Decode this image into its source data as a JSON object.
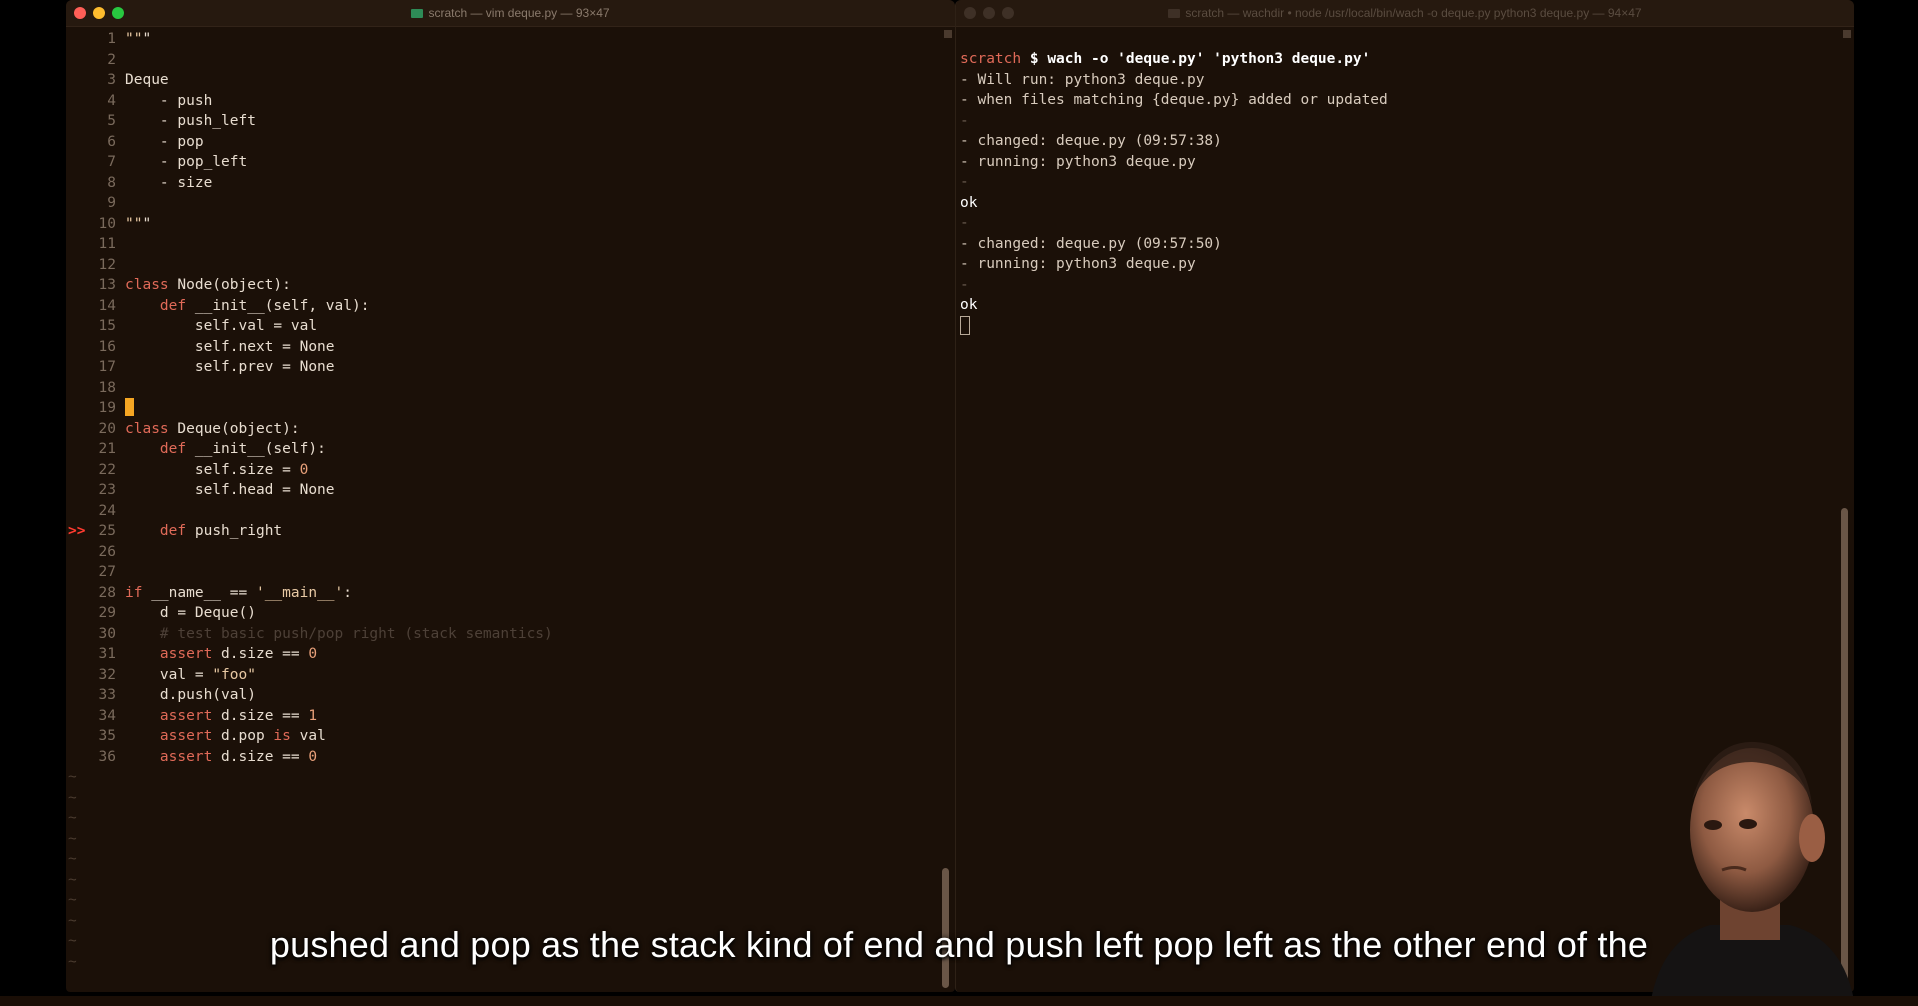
{
  "colors": {
    "close": "#ff5f57",
    "minimize": "#febc2e",
    "maximize": "#28c840",
    "folder": "#2e8b57"
  },
  "vim_window": {
    "title": "scratch — vim deque.py — 93×47",
    "lines": [
      {
        "n": "1",
        "t": "\"\"\""
      },
      {
        "n": "2",
        "t": ""
      },
      {
        "n": "3",
        "t": "Deque"
      },
      {
        "n": "4",
        "t": "    - push"
      },
      {
        "n": "5",
        "t": "    - push_left"
      },
      {
        "n": "6",
        "t": "    - pop"
      },
      {
        "n": "7",
        "t": "    - pop_left"
      },
      {
        "n": "8",
        "t": "    - size"
      },
      {
        "n": "9",
        "t": ""
      },
      {
        "n": "10",
        "t": "\"\"\""
      },
      {
        "n": "11",
        "t": ""
      },
      {
        "n": "12",
        "t": ""
      },
      {
        "n": "13",
        "t": "class Node(object):"
      },
      {
        "n": "14",
        "t": "    def __init__(self, val):"
      },
      {
        "n": "15",
        "t": "        self.val = val"
      },
      {
        "n": "16",
        "t": "        self.next = None"
      },
      {
        "n": "17",
        "t": "        self.prev = None"
      },
      {
        "n": "18",
        "t": ""
      },
      {
        "n": "19",
        "t": ""
      },
      {
        "n": "20",
        "t": "class Deque(object):"
      },
      {
        "n": "21",
        "t": "    def __init__(self):"
      },
      {
        "n": "22",
        "t": "        self.size = 0"
      },
      {
        "n": "23",
        "t": "        self.head = None"
      },
      {
        "n": "24",
        "t": ""
      },
      {
        "n": "25",
        "t": "    def push_right",
        "sign": ">>"
      },
      {
        "n": "26",
        "t": ""
      },
      {
        "n": "27",
        "t": ""
      },
      {
        "n": "28",
        "t": "if __name__ == '__main__':"
      },
      {
        "n": "29",
        "t": "    d = Deque()"
      },
      {
        "n": "30",
        "t": "    # test basic push/pop right (stack semantics)"
      },
      {
        "n": "31",
        "t": "    assert d.size == 0"
      },
      {
        "n": "32",
        "t": "    val = \"foo\""
      },
      {
        "n": "33",
        "t": "    d.push(val)"
      },
      {
        "n": "34",
        "t": "    assert d.size == 1"
      },
      {
        "n": "35",
        "t": "    assert d.pop is val"
      },
      {
        "n": "36",
        "t": "    assert d.size == 0"
      }
    ],
    "tilde_marker": "~",
    "tilde_count": 10
  },
  "terminal_window": {
    "title": "scratch — wachdir • node /usr/local/bin/wach -o deque.py python3 deque.py — 94×47",
    "prompt_dir": "scratch",
    "prompt_symbol": "$",
    "command": "wach -o 'deque.py' 'python3 deque.py'",
    "output": [
      "- Will run: python3 deque.py",
      "- when files matching {deque.py} added or updated",
      "-",
      "- changed: deque.py (09:57:38)",
      "- running: python3 deque.py",
      "-",
      "ok",
      "-",
      "- changed: deque.py (09:57:50)",
      "- running: python3 deque.py",
      "-",
      "ok"
    ]
  },
  "caption": "pushed and pop as the stack kind of end and push left pop left as the other end of the"
}
